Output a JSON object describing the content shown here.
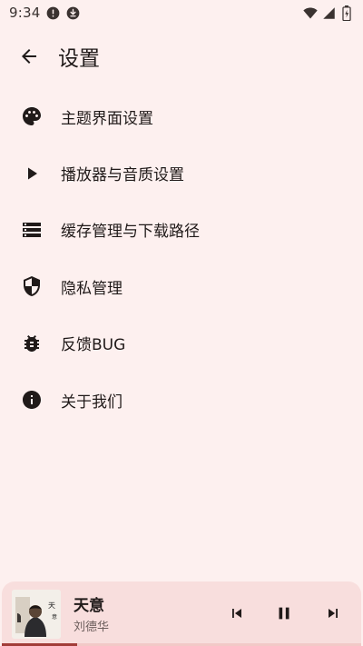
{
  "status_bar": {
    "time": "9:34",
    "icons": [
      "alert-circle-icon",
      "download-icon",
      "wifi-icon",
      "cell-signal-icon",
      "battery-icon"
    ]
  },
  "app_bar": {
    "back_icon": "arrow-back-icon",
    "title": "设置"
  },
  "settings": {
    "items": [
      {
        "icon": "palette-icon",
        "label": "主题界面设置"
      },
      {
        "icon": "play-icon",
        "label": "播放器与音质设置"
      },
      {
        "icon": "storage-icon",
        "label": "缓存管理与下载路径"
      },
      {
        "icon": "shield-icon",
        "label": "隐私管理"
      },
      {
        "icon": "bug-icon",
        "label": "反馈BUG"
      },
      {
        "icon": "info-icon",
        "label": "关于我们"
      }
    ]
  },
  "mini_player": {
    "title": "天意",
    "artist": "刘德华",
    "progress": 0.21,
    "controls": [
      "skip-previous-icon",
      "pause-icon",
      "skip-next-icon"
    ]
  },
  "colors": {
    "background": "#fdf0ef",
    "player_background": "#f8dedd",
    "text": "#201a19",
    "secondary_text": "#6d5f5d",
    "accent": "#a23c38"
  }
}
